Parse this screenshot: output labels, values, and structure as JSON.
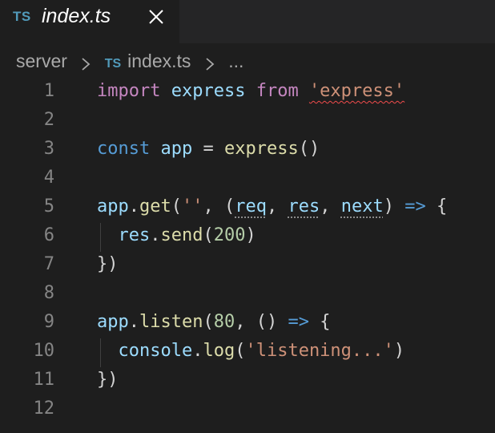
{
  "tab": {
    "lang_badge": "TS",
    "title": "index.ts"
  },
  "breadcrumb": {
    "folder": "server",
    "file_badge": "TS",
    "file": "index.ts",
    "more": "..."
  },
  "editor": {
    "line_numbers": [
      "1",
      "2",
      "3",
      "4",
      "5",
      "6",
      "7",
      "8",
      "9",
      "10",
      "11",
      "12"
    ],
    "lines": [
      [
        {
          "t": "import",
          "c": "kw-import"
        },
        {
          "t": " ",
          "c": "pun"
        },
        {
          "t": "express",
          "c": "var"
        },
        {
          "t": " ",
          "c": "pun"
        },
        {
          "t": "from",
          "c": "kw-import"
        },
        {
          "t": " ",
          "c": "pun"
        },
        {
          "t": "'express'",
          "c": "str squiggle"
        }
      ],
      [],
      [
        {
          "t": "const",
          "c": "kw"
        },
        {
          "t": " ",
          "c": "pun"
        },
        {
          "t": "app",
          "c": "var"
        },
        {
          "t": " = ",
          "c": "pun"
        },
        {
          "t": "express",
          "c": "fn"
        },
        {
          "t": "()",
          "c": "pun"
        }
      ],
      [],
      [
        {
          "t": "app",
          "c": "var"
        },
        {
          "t": ".",
          "c": "pun"
        },
        {
          "t": "get",
          "c": "fn"
        },
        {
          "t": "(",
          "c": "pun"
        },
        {
          "t": "''",
          "c": "str"
        },
        {
          "t": ", (",
          "c": "pun"
        },
        {
          "t": "req",
          "c": "var hint"
        },
        {
          "t": ", ",
          "c": "pun"
        },
        {
          "t": "res",
          "c": "var hint"
        },
        {
          "t": ", ",
          "c": "pun"
        },
        {
          "t": "next",
          "c": "var hint"
        },
        {
          "t": ") ",
          "c": "pun"
        },
        {
          "t": "=>",
          "c": "kw"
        },
        {
          "t": " {",
          "c": "pun"
        }
      ],
      [
        {
          "t": "  ",
          "c": "pun"
        },
        {
          "t": "res",
          "c": "var"
        },
        {
          "t": ".",
          "c": "pun"
        },
        {
          "t": "send",
          "c": "fn"
        },
        {
          "t": "(",
          "c": "pun"
        },
        {
          "t": "200",
          "c": "num"
        },
        {
          "t": ")",
          "c": "pun"
        }
      ],
      [
        {
          "t": "})",
          "c": "pun"
        }
      ],
      [],
      [
        {
          "t": "app",
          "c": "var"
        },
        {
          "t": ".",
          "c": "pun"
        },
        {
          "t": "listen",
          "c": "fn"
        },
        {
          "t": "(",
          "c": "pun"
        },
        {
          "t": "80",
          "c": "num"
        },
        {
          "t": ", () ",
          "c": "pun"
        },
        {
          "t": "=>",
          "c": "kw"
        },
        {
          "t": " {",
          "c": "pun"
        }
      ],
      [
        {
          "t": "  ",
          "c": "pun"
        },
        {
          "t": "console",
          "c": "var"
        },
        {
          "t": ".",
          "c": "pun"
        },
        {
          "t": "log",
          "c": "fn"
        },
        {
          "t": "(",
          "c": "pun"
        },
        {
          "t": "'listening...'",
          "c": "str"
        },
        {
          "t": ")",
          "c": "pun"
        }
      ],
      [
        {
          "t": "})",
          "c": "pun"
        }
      ],
      []
    ]
  }
}
